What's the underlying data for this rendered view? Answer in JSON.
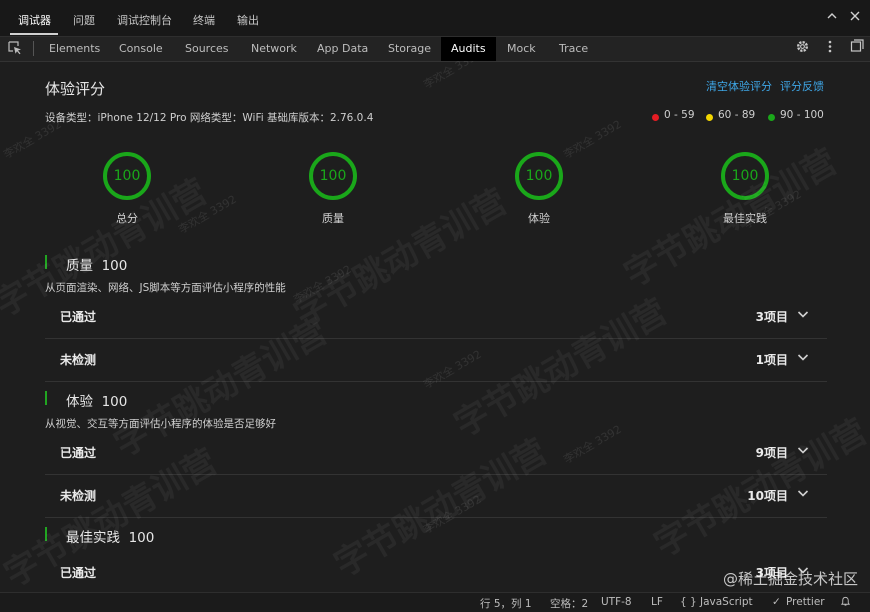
{
  "top_tabs": [
    "调试器",
    "问题",
    "调试控制台",
    "终端",
    "输出"
  ],
  "dev_tabs": [
    "Elements",
    "Console",
    "Sources",
    "Network",
    "App Data",
    "Storage",
    "Audits",
    "Mock",
    "Trace"
  ],
  "active_dev_tab": "Audits",
  "page": {
    "title": "体验评分",
    "clear_link": "清空体验评分",
    "feedback_link": "评分反馈",
    "device_info": "设备类型：iPhone 12/12 Pro 网络类型：WiFi 基础库版本：2.76.0.4",
    "legend": [
      {
        "label": "0 - 59",
        "color": "#e51c23"
      },
      {
        "label": "60 - 89",
        "color": "#f2d600"
      },
      {
        "label": "90 - 100",
        "color": "#1aa71a"
      }
    ]
  },
  "scores": [
    {
      "value": "100",
      "label": "总分",
      "color": "#1aa71a"
    },
    {
      "value": "100",
      "label": "质量",
      "color": "#1aa71a"
    },
    {
      "value": "100",
      "label": "体验",
      "color": "#1aa71a"
    },
    {
      "value": "100",
      "label": "最佳实践",
      "color": "#1aa71a"
    }
  ],
  "sections": [
    {
      "title": "质量",
      "score": "100",
      "desc": "从页面渲染、网络、JS脚本等方面评估小程序的性能",
      "rows": [
        {
          "label": "已通过",
          "count": "3项目"
        },
        {
          "label": "未检测",
          "count": "1项目"
        }
      ]
    },
    {
      "title": "体验",
      "score": "100",
      "desc": "从视觉、交互等方面评估小程序的体验是否足够好",
      "rows": [
        {
          "label": "已通过",
          "count": "9项目"
        },
        {
          "label": "未检测",
          "count": "10项目"
        }
      ]
    },
    {
      "title": "最佳实践",
      "score": "100",
      "desc": "",
      "rows": [
        {
          "label": "已通过",
          "count": "3项目"
        }
      ]
    }
  ],
  "status": {
    "position": "行 5，列 1",
    "spaces": "空格：2",
    "encoding": "UTF-8",
    "eol": "LF",
    "language_braces": "{ }",
    "language": "JavaScript",
    "formatter": "Prettier"
  },
  "watermarks": {
    "main": "字节跳动青训营",
    "user": "李欢全 3392",
    "brand": "@稀土掘金技术社区"
  }
}
